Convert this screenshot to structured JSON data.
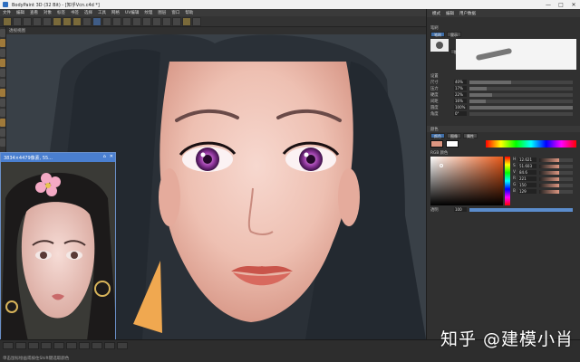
{
  "window": {
    "title": "BodyPaint 3D (32 Bit) - [知乎Vcn.c4d *]",
    "controls": [
      "—",
      "□",
      "✕"
    ]
  },
  "menu": {
    "items": [
      "文件",
      "编辑",
      "查看",
      "对象",
      "标签",
      "书签",
      "选择",
      "工具",
      "网格",
      "UV编辑",
      "纹理",
      "图层",
      "窗口",
      "帮助"
    ]
  },
  "viewport": {
    "label": "透视视图"
  },
  "float_window": {
    "title": "3834×4479像素, 55..."
  },
  "right_panel": {
    "tabs": [
      "模式",
      "编辑",
      "用户数据"
    ],
    "brush_header": "笔刷",
    "brush_tab_active": "笔刷",
    "brush_subtab": "显示",
    "load_button": "加载预置",
    "save_button": "保存预置",
    "settings_header": "设置",
    "settings": [
      {
        "label": "尺寸",
        "value": "40",
        "unit": "%",
        "fill": 0.4
      },
      {
        "label": "压力",
        "value": "17",
        "unit": "%",
        "fill": 0.17
      },
      {
        "label": "硬度",
        "value": "22",
        "unit": "%",
        "fill": 0.22
      },
      {
        "label": "间距",
        "value": "16",
        "unit": "%",
        "fill": 0.16
      },
      {
        "label": "圆度",
        "value": "100",
        "unit": "%",
        "fill": 1.0
      },
      {
        "label": "角度",
        "value": "0",
        "unit": "°",
        "fill": 0.0
      }
    ],
    "color_header": "颜色",
    "color_tabs": [
      "颜色",
      "图像",
      "属性"
    ],
    "color_mode_label": "RGB 颜色",
    "channels": [
      {
        "label": "H",
        "value": "12.621"
      },
      {
        "label": "S",
        "value": "51.603"
      },
      {
        "label": "V",
        "value": "84.6"
      },
      {
        "label": "R",
        "value": "221"
      },
      {
        "label": "G",
        "value": "150"
      },
      {
        "label": "B",
        "value": "129"
      }
    ],
    "opacity_label": "透明",
    "opacity_value": "100",
    "current_color": "#dd9681"
  },
  "status": {
    "message": "单击鼠标绘画或按住Shift键选取颜色"
  },
  "watermark": "知乎 @建模小肖"
}
